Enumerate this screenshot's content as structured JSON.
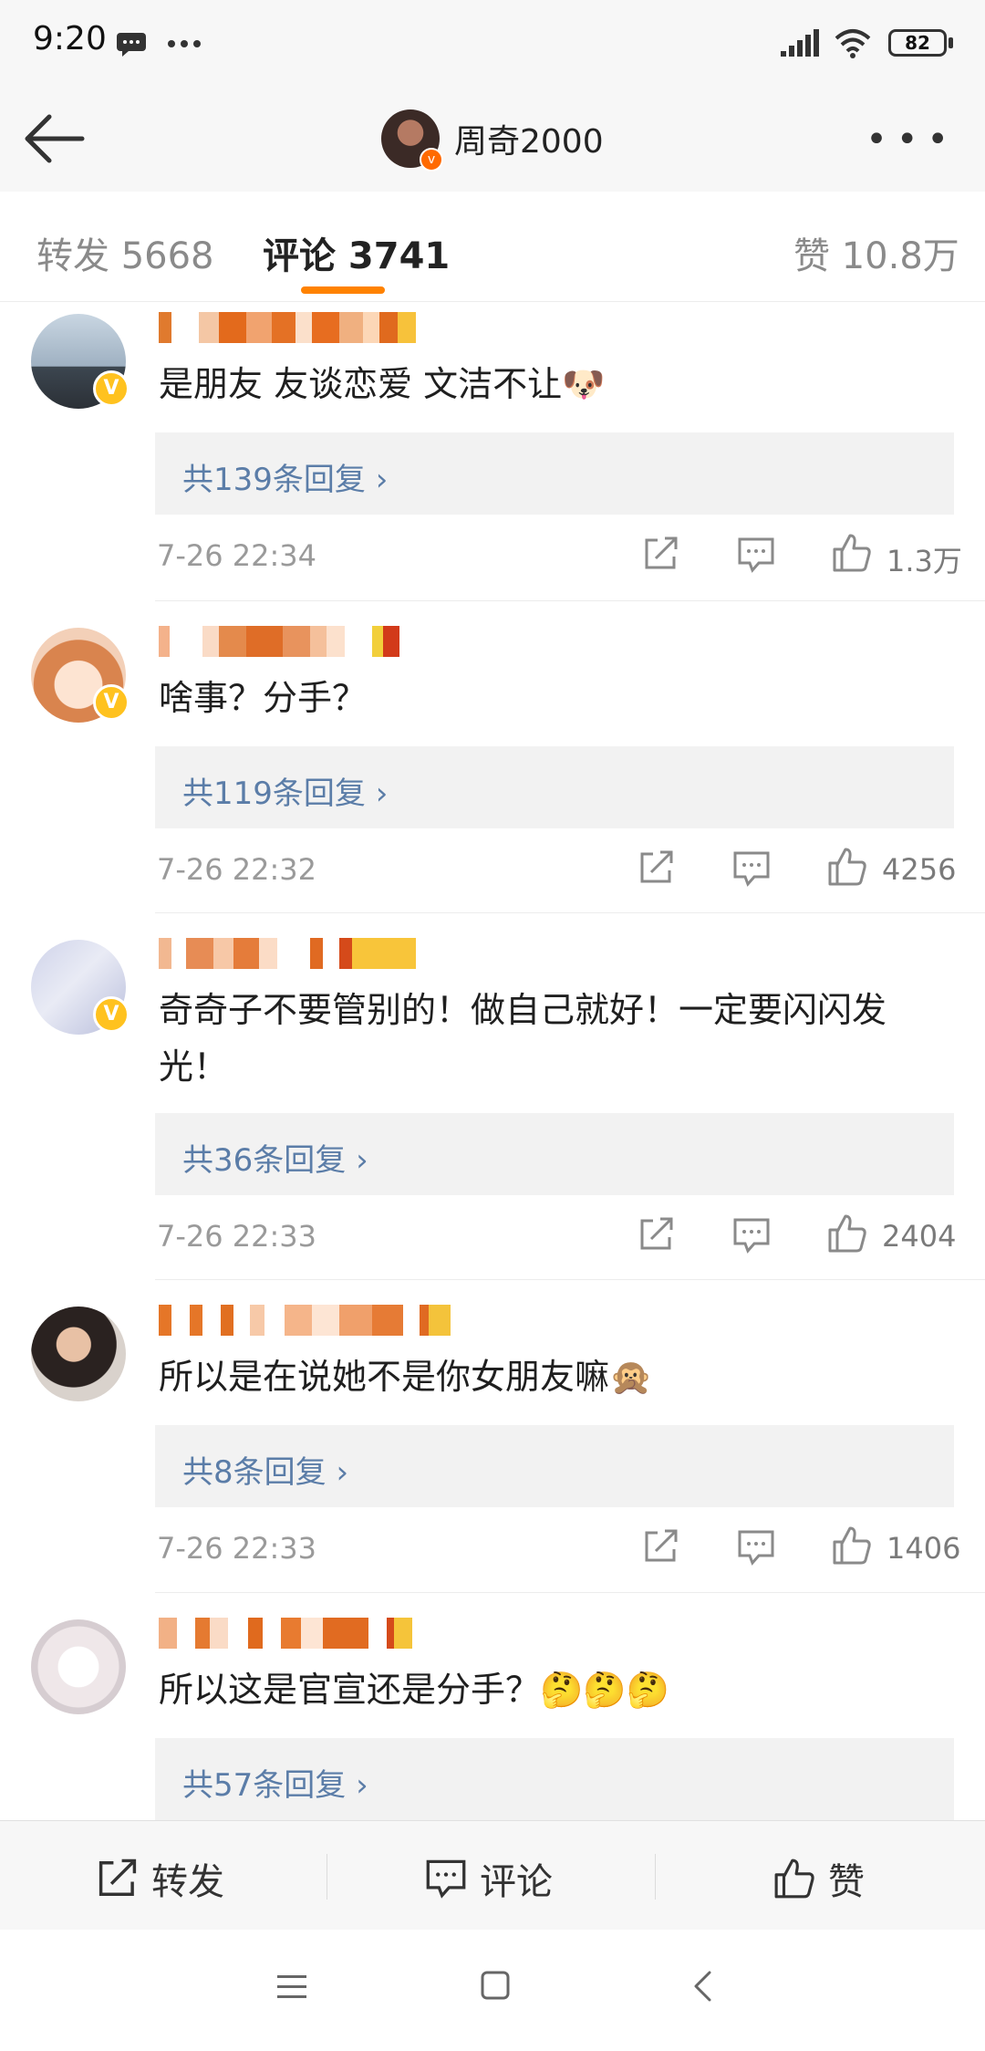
{
  "status_bar": {
    "time": "9:20",
    "battery": "82"
  },
  "header": {
    "title": "周奇2000"
  },
  "tabs": [
    {
      "label": "转发 5668"
    },
    {
      "label": "评论 3741"
    },
    {
      "label": "赞 10.8万"
    }
  ],
  "comments": [
    {
      "text": "是朋友 友谈恋爱 文洁不让🐶",
      "replies": "共139条回复 ›",
      "time": "7-26 22:34",
      "likes": "1.3万"
    },
    {
      "text": "啥事？分手？",
      "replies": "共119条回复 ›",
      "time": "7-26 22:32",
      "likes": "4256"
    },
    {
      "text": "奇奇子不要管别的！做自己就好！一定要闪闪发光！",
      "replies": "共36条回复 ›",
      "time": "7-26 22:33",
      "likes": "2404"
    },
    {
      "text": "所以是在说她不是你女朋友嘛🙊",
      "replies": "共8条回复 ›",
      "time": "7-26 22:33",
      "likes": "1406"
    },
    {
      "text": "所以这是官宣还是分手？🤔🤔🤔",
      "replies": "共57条回复 ›",
      "time": "",
      "likes": ""
    }
  ],
  "actionbar": {
    "repost": "转发",
    "comment": "评论",
    "like": "赞"
  },
  "colors": {
    "accent": "#ff8200",
    "link": "#5b7da8",
    "verified": "#ffc21f"
  }
}
